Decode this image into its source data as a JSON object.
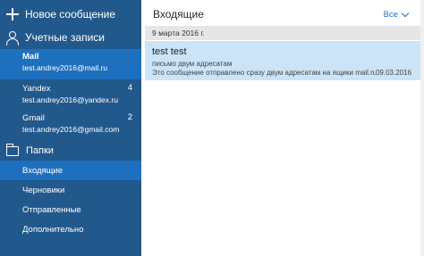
{
  "sidebar": {
    "new_mail_label": "Новое сообщение",
    "accounts_label": "Учетные записи",
    "accounts": [
      {
        "name": "Mail",
        "email": "test.andrey2016@mail.ru",
        "count": ""
      },
      {
        "name": "Yandex",
        "email": "test.andrey2016@yandex.ru",
        "count": "4"
      },
      {
        "name": "Gmail",
        "email": "test.andrey2016@gmail.com",
        "count": "2"
      }
    ],
    "folders_label": "Папки",
    "folders": [
      {
        "label": "Входящие"
      },
      {
        "label": "Черновики"
      },
      {
        "label": "Отправленные"
      },
      {
        "label": "Дополнительно"
      }
    ]
  },
  "main": {
    "title": "Входящие",
    "filter_label": "Все",
    "date_group": "9 марта 2016 г.",
    "message": {
      "from": "test test",
      "subject": "письмо двум адресатам",
      "preview": "Это сообщение отправлено сразу двум адресатам на ящики mail.ru и gn",
      "date": "09.03.2016"
    }
  },
  "colors": {
    "sidebar_bg": "#22598c",
    "active_bg": "#1f6fbf",
    "selected_message_bg": "#cce4f7",
    "accent": "#1f6fbf"
  }
}
